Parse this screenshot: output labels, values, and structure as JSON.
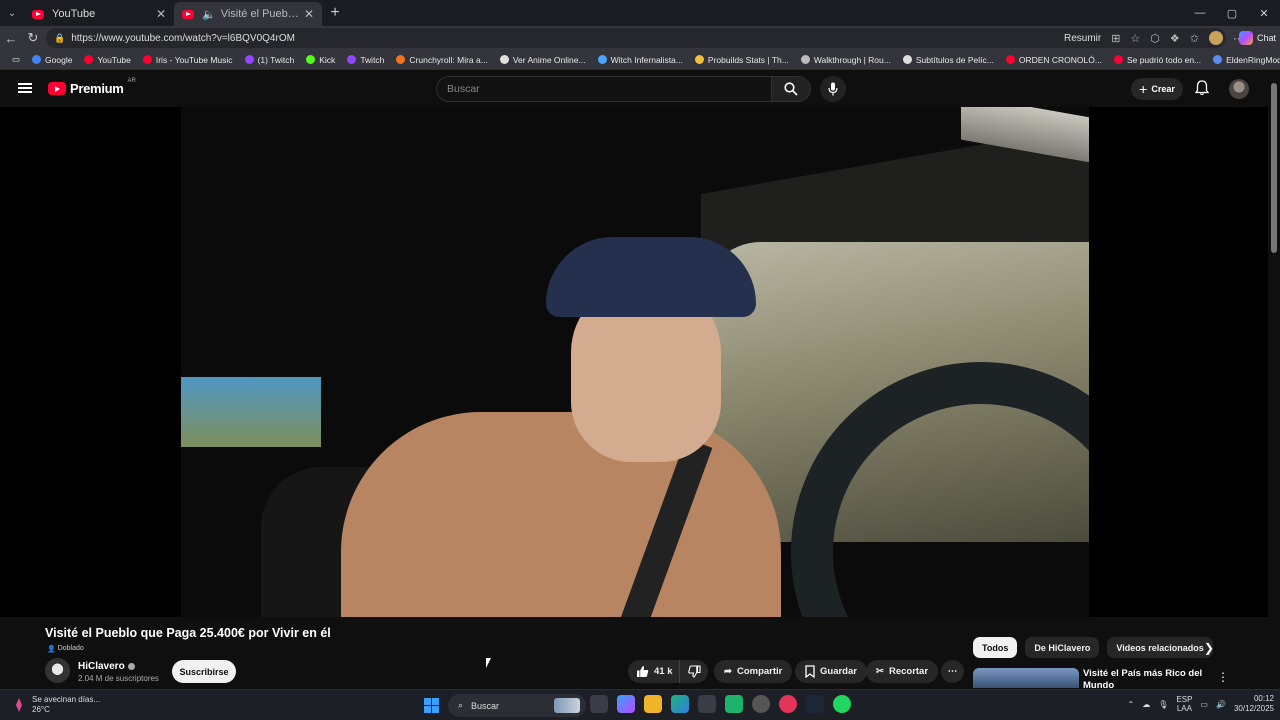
{
  "browser": {
    "tabs": [
      {
        "title": "YouTube",
        "active": false
      },
      {
        "title": "Visité el Pueblo que Paga 25...",
        "active": true
      }
    ],
    "url": "https://www.youtube.com/watch?v=l6BQV0Q4rOM",
    "summarize_label": "Resumir",
    "chat_label": "Chat",
    "bookmarks": [
      {
        "label": "Google",
        "color": "#4285f4"
      },
      {
        "label": "YouTube",
        "color": "#ff0033"
      },
      {
        "label": "Iris - YouTube Music",
        "color": "#ff0033"
      },
      {
        "label": "(1) Twitch",
        "color": "#9146ff"
      },
      {
        "label": "Kick",
        "color": "#53fc18"
      },
      {
        "label": "Twitch",
        "color": "#9146ff"
      },
      {
        "label": "Crunchyroll: Mira a...",
        "color": "#f47521"
      },
      {
        "label": "Ver Anime Online...",
        "color": "#e0e0e0"
      },
      {
        "label": "Witch Infernalista...",
        "color": "#4aa3ff"
      },
      {
        "label": "Probuilds Stats | Th...",
        "color": "#f0c040"
      },
      {
        "label": "Walkthrough | Rou...",
        "color": "#bbbbbb"
      },
      {
        "label": "Subtítulos de Pelíc...",
        "color": "#dddddd"
      },
      {
        "label": "ORDEN CRONOLÓ...",
        "color": "#ff0033"
      },
      {
        "label": "Se pudrió todo en...",
        "color": "#ff0033"
      },
      {
        "label": "EldenRingModPac...",
        "color": "#5b8def"
      }
    ]
  },
  "youtube": {
    "logo_text": "Premium",
    "region": "AR",
    "search_placeholder": "Buscar",
    "create_label": "Crear"
  },
  "video": {
    "title": "Visité el Pueblo que Paga 25.400€ por Vivir en él",
    "dubbed_label": "Doblado",
    "channel": "HiClavero",
    "subscribers": "2.04 M de suscriptores",
    "subscribe_label": "Suscribirse",
    "likes": "41 k",
    "share_label": "Compartir",
    "save_label": "Guardar",
    "clip_label": "Recortar"
  },
  "sidebar": {
    "chips": [
      "Todos",
      "De HiClavero",
      "Videos relacionados"
    ],
    "recommendation_title": "Visité el País más Rico del Mundo"
  },
  "taskbar": {
    "weather_text": "Se avecinan días...",
    "temperature": "26°C",
    "search_placeholder": "Buscar",
    "lang_line1": "ESP",
    "lang_line2": "LAA",
    "time": "00:12",
    "date": "30/12/2025"
  }
}
